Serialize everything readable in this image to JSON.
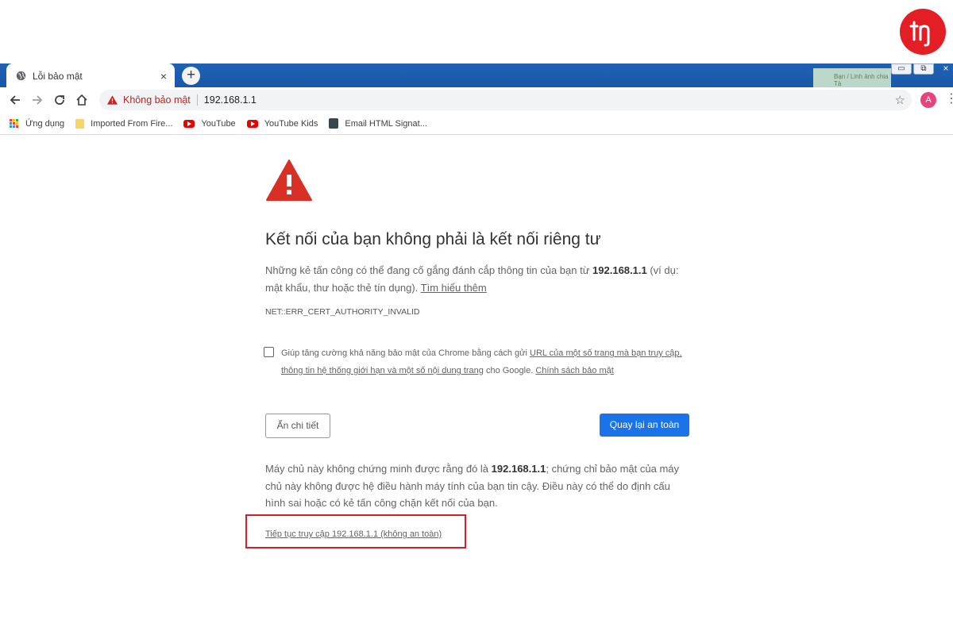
{
  "tab": {
    "title": "Lỗi bảo mật",
    "close_label": "×",
    "new_tab_label": "+"
  },
  "window": {
    "min": "▭",
    "restore": "⧉",
    "close": "×",
    "behind_text": "Bạn / Linh ảnh chia Tà"
  },
  "omnibox": {
    "security_label": "Không bảo mật",
    "url": "192.168.1.1",
    "star_icon": "star-icon"
  },
  "profile": {
    "avatar_letter": "A"
  },
  "bookmarks": [
    {
      "label": "Ứng dụng",
      "icon": "apps-grid-icon"
    },
    {
      "label": "Imported From Fire...",
      "icon": "folder-icon"
    },
    {
      "label": "YouTube",
      "icon": "youtube-icon"
    },
    {
      "label": "YouTube Kids",
      "icon": "youtube-icon"
    },
    {
      "label": "Email HTML Signat...",
      "icon": "document-icon"
    }
  ],
  "interstitial": {
    "heading": "Kết nối của bạn không phải là kết nối riêng tư",
    "desc_before": "Những kẻ tấn công có thể đang cố gắng đánh cắp thông tin của bạn từ ",
    "desc_host": "192.168.1.1",
    "desc_after": " (ví dụ: mật khẩu, thư hoặc thẻ tín dụng). ",
    "learn_more": "Tìm hiểu thêm",
    "error_code": "NET::ERR_CERT_AUTHORITY_INVALID",
    "optin_before": "Giúp tăng cường khả năng bảo mật của Chrome bằng cách gửi ",
    "optin_link": "URL của một số trang mà bạn truy cập, thông tin hệ thống giới hạn và một số nội dung trang",
    "optin_middle": " cho Google. ",
    "optin_policy": "Chính sách bảo mật",
    "details_button": "Ẩn chi tiết",
    "back_button": "Quay lại an toàn",
    "detail_before": "Máy chủ này không chứng minh được rằng đó là ",
    "detail_host": "192.168.1.1",
    "detail_after": "; chứng chỉ bảo mật của máy chủ này không được hệ điều hành máy tính của bạn tin cậy. Điều này có thể do định cấu hình sai hoặc có kẻ tấn công chặn kết nối của bạn.",
    "proceed_link": "Tiếp tục truy cập 192.168.1.1 (không an toàn)"
  },
  "colors": {
    "accent_blue": "#1a73e8",
    "warning_red": "#d93025",
    "highlight_red": "#d0202a",
    "logo_red": "#e31e24"
  }
}
